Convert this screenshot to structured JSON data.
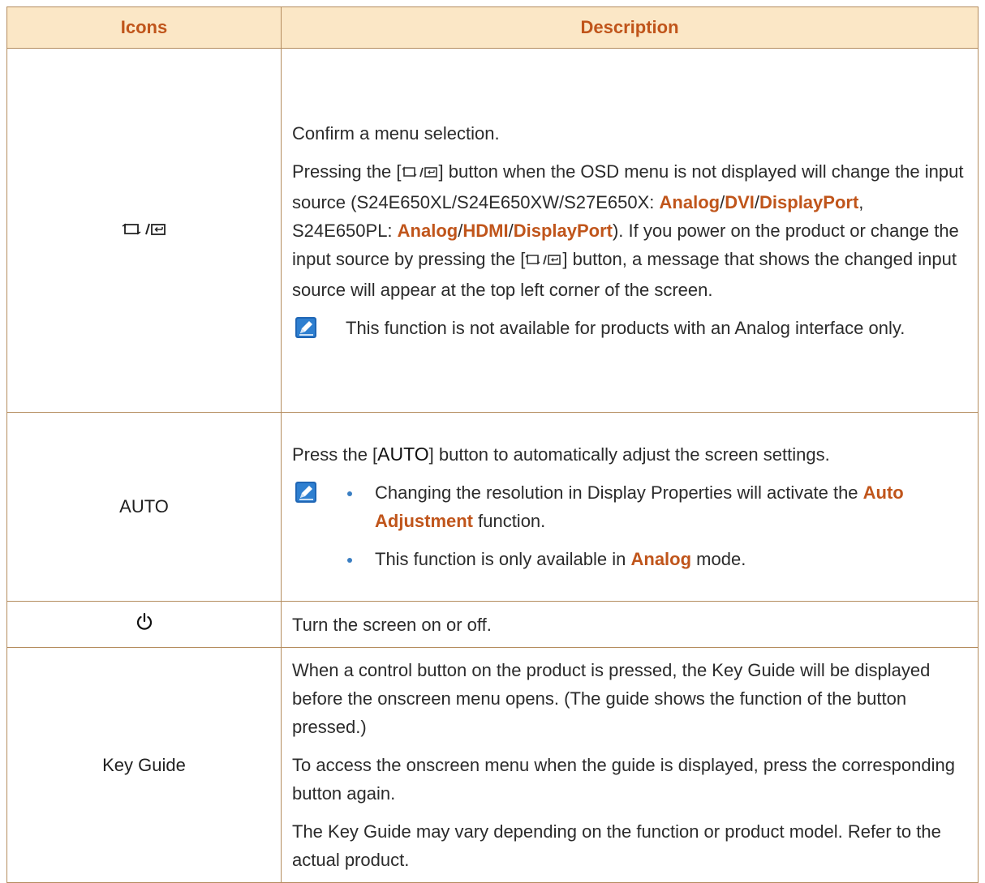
{
  "table": {
    "headers": {
      "icons": "Icons",
      "description": "Description"
    },
    "rows": {
      "source": {
        "icon_name": "source-enter-icon",
        "desc1": "Confirm a menu selection.",
        "p2_a": "Pressing the [",
        "p2_b": "] button when the OSD menu is not displayed will change the input source (S24E650XL/S24E650XW/S27E650X: ",
        "hl_analog": "Analog",
        "sep1": "/",
        "hl_dvi": "DVI",
        "sep2": "/",
        "hl_dp1": "DisplayPort",
        "p2_c": ", S24E650PL: ",
        "hl_analog2": "Analog",
        "sep3": "/",
        "hl_hdmi": "HDMI",
        "sep4": "/",
        "hl_dp2": "DisplayPort",
        "p2_d": "). If you power on the product or change the input source by pressing the [",
        "p2_e": "] button, a message that shows the changed input source will appear at the top left corner of the screen.",
        "note": "This function is not available for products with an Analog interface only."
      },
      "auto": {
        "icon_label": "AUTO",
        "p1_a": "Press the [",
        "p1_key": "AUTO",
        "p1_b": "] button to automatically adjust the screen settings.",
        "b1_a": "Changing the resolution in Display Properties will activate the ",
        "b1_hl": "Auto Adjustment",
        "b1_b": " function.",
        "b2_a": "This function is only available in ",
        "b2_hl": "Analog",
        "b2_b": " mode."
      },
      "power": {
        "icon_name": "power-icon",
        "desc": "Turn the screen on or off."
      },
      "keyguide": {
        "icon_label": "Key Guide",
        "p1": "When a control button on the product is pressed, the Key Guide will be displayed before the onscreen menu opens. (The guide shows the function of the button pressed.)",
        "p2": "To access the onscreen menu when the guide is displayed, press the corresponding button again.",
        "p3": "The Key Guide may vary depending on the function or product model. Refer to the actual product."
      }
    }
  },
  "colors": {
    "header_bg": "#fbe7c6",
    "accent": "#c0551b",
    "border": "#b48c5e",
    "note_icon_blue": "#1f66b5",
    "bullet": "#3a7ec2"
  }
}
